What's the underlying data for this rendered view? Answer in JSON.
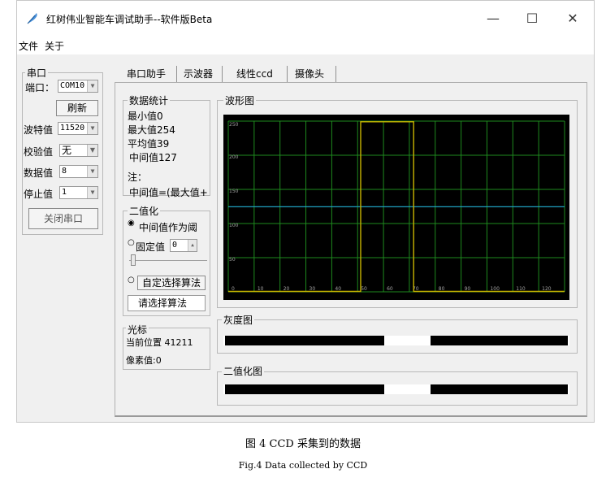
{
  "window": {
    "title": "红树伟业智能车调试助手--软件版Beta",
    "controls": {
      "minimize": "—",
      "maximize": "☐",
      "close": "✕"
    }
  },
  "menu": {
    "file": "文件",
    "about": "关于"
  },
  "serial": {
    "group_title": "串口",
    "port_label": "端口：",
    "port_value": "COM10",
    "refresh_label": "刷新",
    "baud_label": "波特值",
    "baud_value": "11520",
    "parity_label": "校验值",
    "parity_value": "无",
    "data_label": "数据值",
    "data_value": "8",
    "stop_label": "停止值",
    "stop_value": "1",
    "close_port_label": "关闭串口"
  },
  "tabs": [
    {
      "label": "串口助手"
    },
    {
      "label": "示波器"
    },
    {
      "label": "线性ccd"
    },
    {
      "label": "摄像头"
    }
  ],
  "stats": {
    "title": "数据统计",
    "min": "最小值0",
    "max": "最大值254",
    "avg": "平均值39",
    "mid": "中间值127",
    "note": "注：",
    "note_text": "中间值=(最大值+"
  },
  "binarize": {
    "title": "二值化",
    "option_mid": "中间值作为阈",
    "option_fixed": "固定值",
    "fixed_value": "0",
    "option_custom": "自定选择算法",
    "select_algorithm": "请选择算法"
  },
  "cursor": {
    "title": "光标",
    "position": "当前位置  41211",
    "pixel": "像素值:0"
  },
  "waveform": {
    "title": "波形图",
    "x_ticks": [
      "0",
      "10",
      "20",
      "30",
      "40",
      "50",
      "60",
      "70",
      "80",
      "90",
      "100",
      "110",
      "120"
    ],
    "y_ticks": [
      "250",
      "200",
      "150",
      "100",
      "50"
    ],
    "signal_low": 0,
    "signal_high": 254,
    "pulse_start": 50,
    "pulse_end": 70,
    "x_max": 127,
    "colors": {
      "background": "#000000",
      "grid": "#1e8a1e",
      "signal": "#c8b400",
      "threshold": "#20a0c0"
    },
    "threshold": 127
  },
  "gray_title": "灰度图",
  "binary_title": "二值化图",
  "caption_cn": "图 4 CCD 采集到的数据",
  "caption_en": "Fig.4 Data collected by CCD"
}
